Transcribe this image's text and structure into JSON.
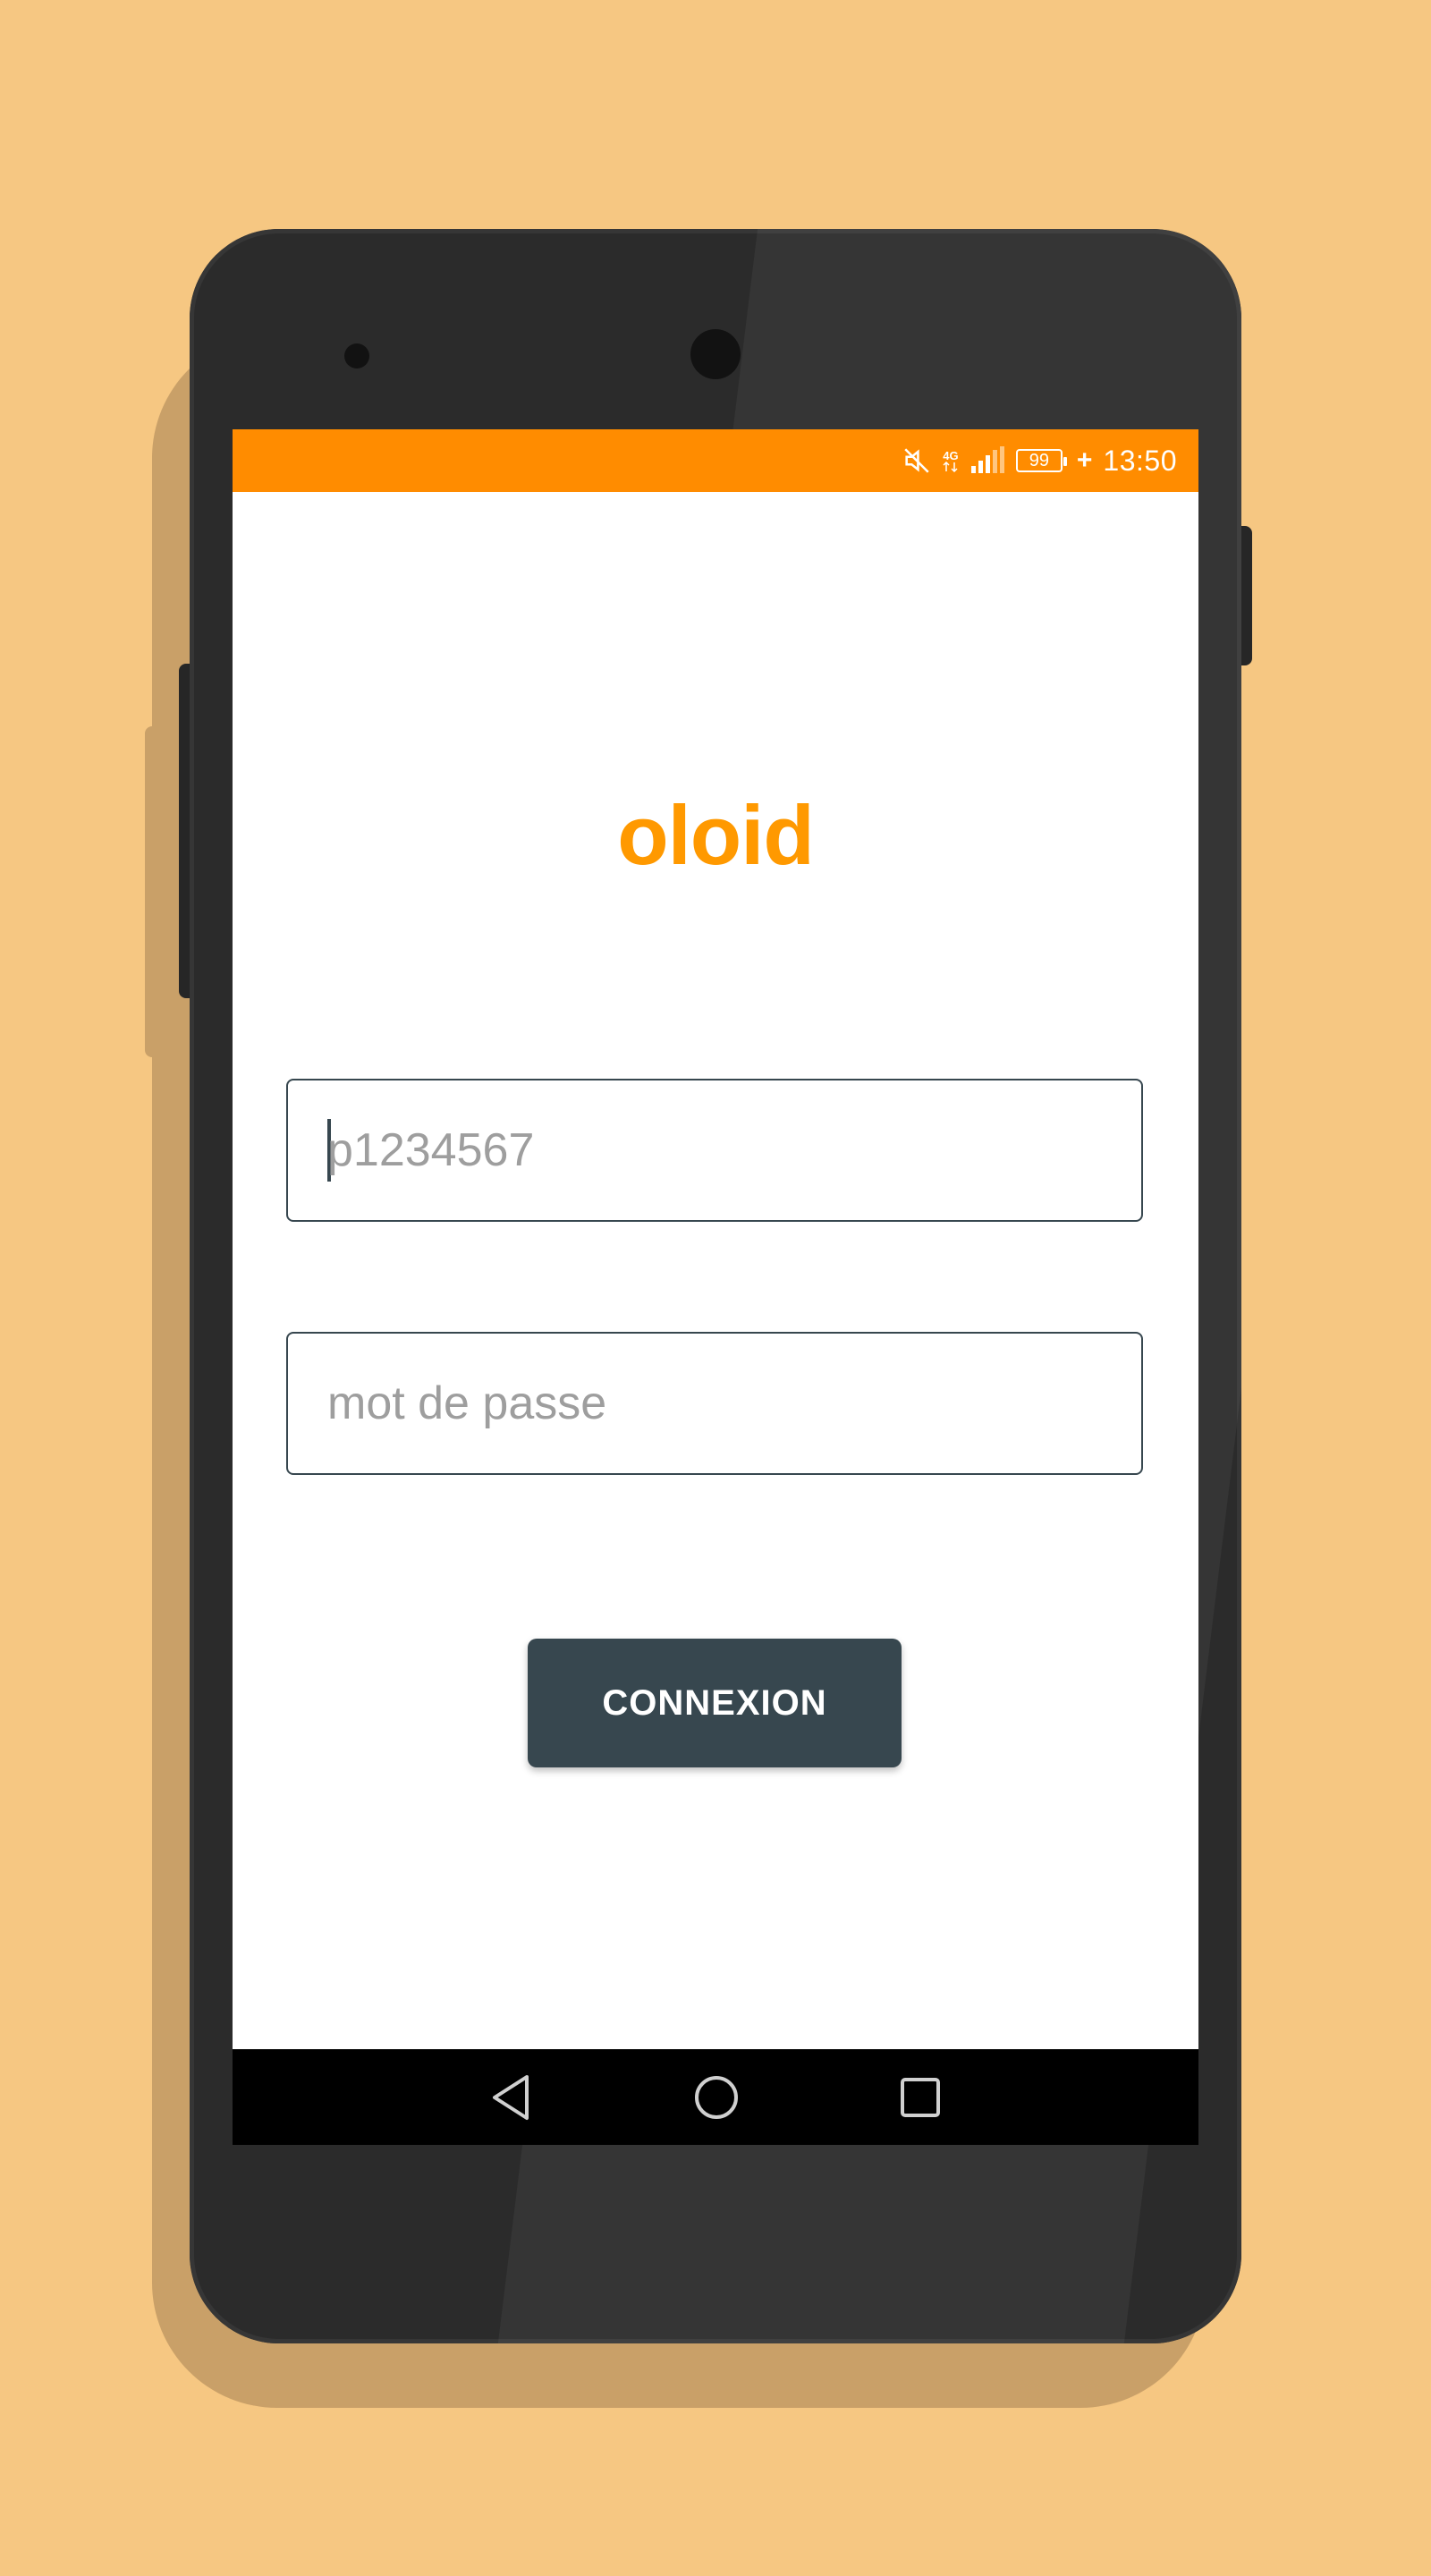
{
  "colors": {
    "background": "#f6c782",
    "status_bar": "#ff8c00",
    "app_title": "#ff9900",
    "button": "#37474f",
    "nav_bar": "#000000"
  },
  "status_bar": {
    "icons": [
      "mute-icon",
      "4g-icon",
      "signal-icon"
    ],
    "network": "4G",
    "battery_level": "99",
    "charging_symbol": "+",
    "time": "13:50"
  },
  "login": {
    "app_title": "oloid",
    "username_placeholder": "p1234567",
    "password_placeholder": "mot de passe",
    "submit_label": "CONNEXION"
  },
  "nav_bar": {
    "icons": [
      "back-icon",
      "home-icon",
      "recents-icon"
    ]
  }
}
